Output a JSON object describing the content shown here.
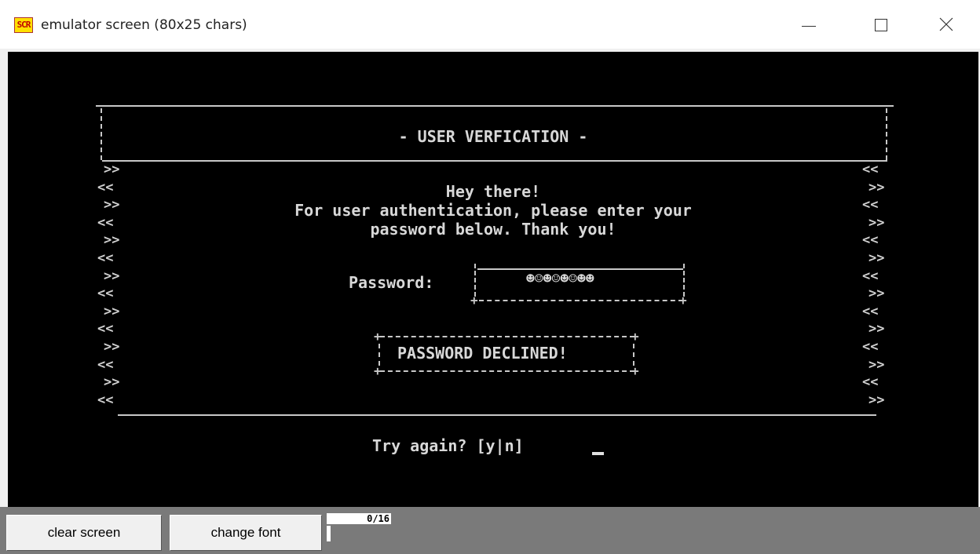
{
  "window": {
    "title": "emulator screen (80x25 chars)",
    "icon_label": "SCR",
    "buttons": [
      "minimize-icon",
      "maximize-icon",
      "close-icon"
    ]
  },
  "screen": {
    "heading": "- USER VERFICATION -",
    "greeting": "Hey there!",
    "message_line1": "For user authentication, please enter your",
    "message_line2": "password below. Thank you!",
    "password_label": "Password:",
    "password_value": "☻☺☻☺☻☺☻☻",
    "status": "PASSWORD DECLINED!",
    "prompt": "Try again? [y|n]",
    "border_left": [
      ">>",
      "<<",
      ">>",
      "<<",
      ">>",
      "<<",
      ">>",
      "<<",
      ">>",
      "<<",
      ">>",
      "<<",
      ">>",
      "<<"
    ],
    "border_right": [
      "<<",
      ">>",
      "<<",
      ">>",
      "<<",
      ">>",
      "<<",
      ">>",
      "<<",
      ">>",
      "<<",
      ">>",
      "<<",
      ">>"
    ]
  },
  "toolbar": {
    "clear_label": "clear screen",
    "font_label": "change font",
    "counter": "0/16"
  },
  "colors": {
    "screen_bg": "#000000",
    "screen_text": "#d8d8d8",
    "toolbar_bg": "#7a7a7a"
  }
}
